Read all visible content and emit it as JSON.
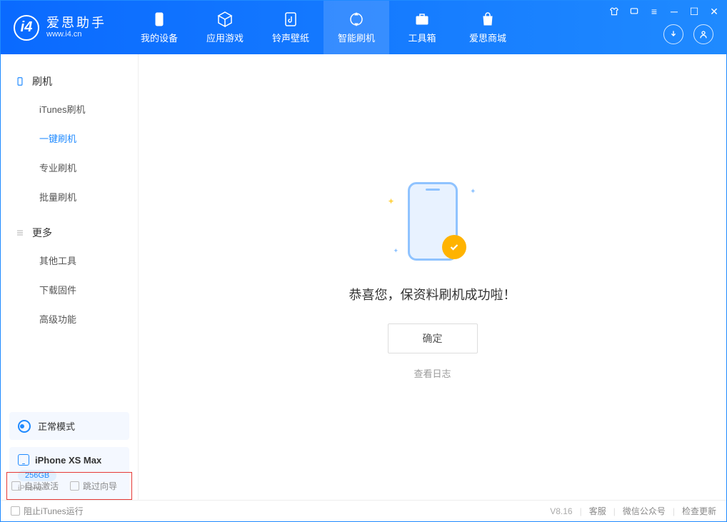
{
  "app": {
    "title": "爱思助手",
    "subtitle": "www.i4.cn"
  },
  "nav": {
    "items": [
      {
        "label": "我的设备"
      },
      {
        "label": "应用游戏"
      },
      {
        "label": "铃声壁纸"
      },
      {
        "label": "智能刷机"
      },
      {
        "label": "工具箱"
      },
      {
        "label": "爱思商城"
      }
    ]
  },
  "sidebar": {
    "group1_title": "刷机",
    "group1_items": [
      "iTunes刷机",
      "一键刷机",
      "专业刷机",
      "批量刷机"
    ],
    "group2_title": "更多",
    "group2_items": [
      "其他工具",
      "下载固件",
      "高级功能"
    ]
  },
  "mode": {
    "label": "正常模式"
  },
  "device": {
    "name": "iPhone XS Max",
    "capacity": "256GB",
    "type": "iPhone"
  },
  "checks": {
    "auto_activate": "自动激活",
    "skip_guide": "跳过向导"
  },
  "main": {
    "success": "恭喜您，保资料刷机成功啦！",
    "ok": "确定",
    "view_log": "查看日志"
  },
  "footer": {
    "block_itunes": "阻止iTunes运行",
    "version": "V8.16",
    "support": "客服",
    "wechat": "微信公众号",
    "update": "检查更新"
  }
}
